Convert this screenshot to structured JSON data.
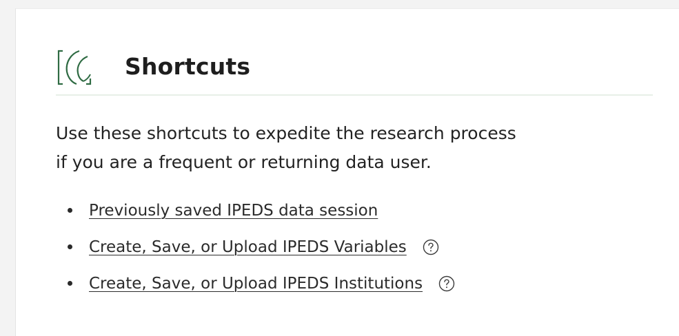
{
  "section": {
    "title": "Shortcuts",
    "logo_icon": "bracket-leaf-logo",
    "description_line1": "Use these shortcuts to expedite the research process",
    "description_line2": "if you are a frequent or returning data user."
  },
  "shortcuts": [
    {
      "label": "Previously saved IPEDS data session",
      "has_help": false
    },
    {
      "label": "Create, Save, or Upload IPEDS Variables",
      "has_help": true,
      "help_icon": "question-circle-icon"
    },
    {
      "label": "Create, Save, or Upload IPEDS Institutions",
      "has_help": true,
      "help_icon": "question-circle-icon"
    }
  ],
  "colors": {
    "logo_green": "#2f6b43",
    "divider": "#e7efe7",
    "text": "#222222"
  }
}
